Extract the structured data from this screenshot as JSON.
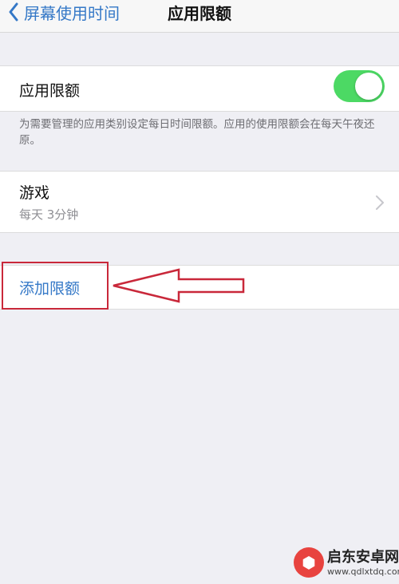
{
  "navbar": {
    "back_label": "屏幕使用时间",
    "title": "应用限额"
  },
  "limits_toggle": {
    "label": "应用限额",
    "enabled": true,
    "footer": "为需要管理的应用类别设定每日时间限额。应用的使用限额会在每天午夜还原。"
  },
  "limit_item": {
    "title": "游戏",
    "subtitle": "每天 3分钟"
  },
  "add_limit": {
    "label": "添加限额"
  },
  "watermark": {
    "name": "启东安卓网",
    "url": "www.qdlxtdq.com"
  },
  "colors": {
    "accent": "#3478c7",
    "toggle_on": "#4cd964",
    "annotation": "#c9283a"
  },
  "icons": {
    "back": "chevron-left-icon",
    "disclosure": "chevron-right-icon"
  }
}
